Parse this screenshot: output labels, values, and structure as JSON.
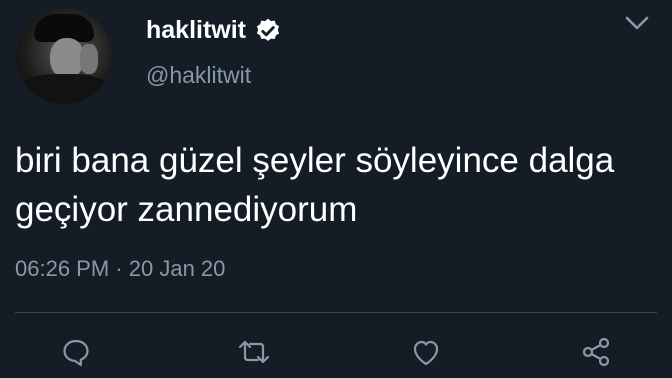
{
  "tweet": {
    "display_name": "haklitwit",
    "handle": "@haklitwit",
    "verified": true,
    "text": "biri bana güzel şeyler söyleyince dalga geçiyor zannediyorum",
    "time": "06:26 PM",
    "separator": "·",
    "date": "20 Jan 20"
  },
  "actions": [
    "reply-icon",
    "retweet-icon",
    "like-icon",
    "share-icon"
  ],
  "colors": {
    "background": "#141d26",
    "text": "#ffffff",
    "secondary": "#8899a6",
    "divider": "#38444d"
  }
}
